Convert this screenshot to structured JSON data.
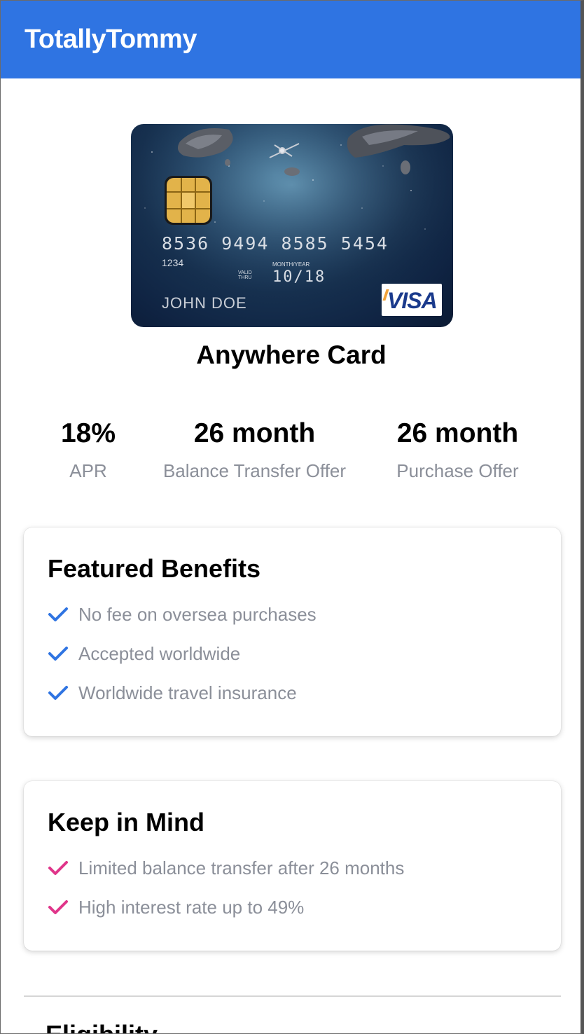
{
  "header": {
    "brand": "TotallyTommy",
    "background": "#2f74e2"
  },
  "card_image": {
    "number": "8536 9494 8585 5454",
    "small_number": "1234",
    "valid_thru_label": "VALID THRU",
    "month_year_label": "MONTH/YEAR",
    "expiry": "10/18",
    "holder": "JOHN DOE",
    "network": "VISA"
  },
  "card_title": "Anywhere Card",
  "stats": [
    {
      "value": "18%",
      "label": "APR"
    },
    {
      "value": "26 month",
      "label": "Balance Transfer Offer"
    },
    {
      "value": "26 month",
      "label": "Purchase Offer"
    }
  ],
  "featured_benefits": {
    "title": "Featured Benefits",
    "check_color": "#2f74e2",
    "items": [
      "No fee on oversea purchases",
      "Accepted worldwide",
      "Worldwide travel insurance"
    ]
  },
  "keep_in_mind": {
    "title": "Keep in Mind",
    "check_color": "#e0358a",
    "items": [
      "Limited balance transfer after 26 months",
      "High interest rate up to 49%"
    ]
  },
  "eligibility": {
    "title": "Eligibility"
  }
}
